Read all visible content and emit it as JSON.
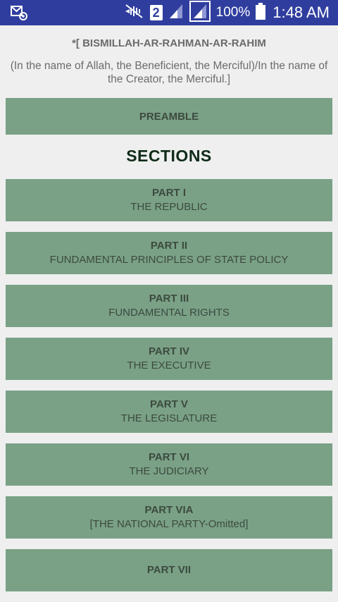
{
  "status_bar": {
    "sim_slot": "2",
    "battery": "100%",
    "time": "1:48 AM"
  },
  "header": {
    "bismillah": "*[ BISMILLAH-AR-RAHMAN-AR-RAHIM",
    "meaning": "(In the name of Allah, the Beneficient, the Merciful)/In the name of the Creator, the Merciful.]"
  },
  "preamble_label": "PREAMBLE",
  "sections_title": "SECTIONS",
  "parts": [
    {
      "title": "PART I",
      "subtitle": "THE REPUBLIC"
    },
    {
      "title": "PART II",
      "subtitle": "FUNDAMENTAL PRINCIPLES OF STATE POLICY"
    },
    {
      "title": "PART III",
      "subtitle": "FUNDAMENTAL RIGHTS"
    },
    {
      "title": "PART IV",
      "subtitle": "THE EXECUTIVE"
    },
    {
      "title": "PART V",
      "subtitle": "THE LEGISLATURE"
    },
    {
      "title": "PART VI",
      "subtitle": "THE JUDICIARY"
    },
    {
      "title": "PART VIA",
      "subtitle": "[THE NATIONAL PARTY-Omitted]"
    },
    {
      "title": "PART VII",
      "subtitle": ""
    }
  ],
  "colors": {
    "status_bar": "#2f3e9e",
    "background": "#efefef",
    "button": "#7aa186",
    "button_text": "#3c4a3f",
    "sections_title": "#0f2a18"
  }
}
